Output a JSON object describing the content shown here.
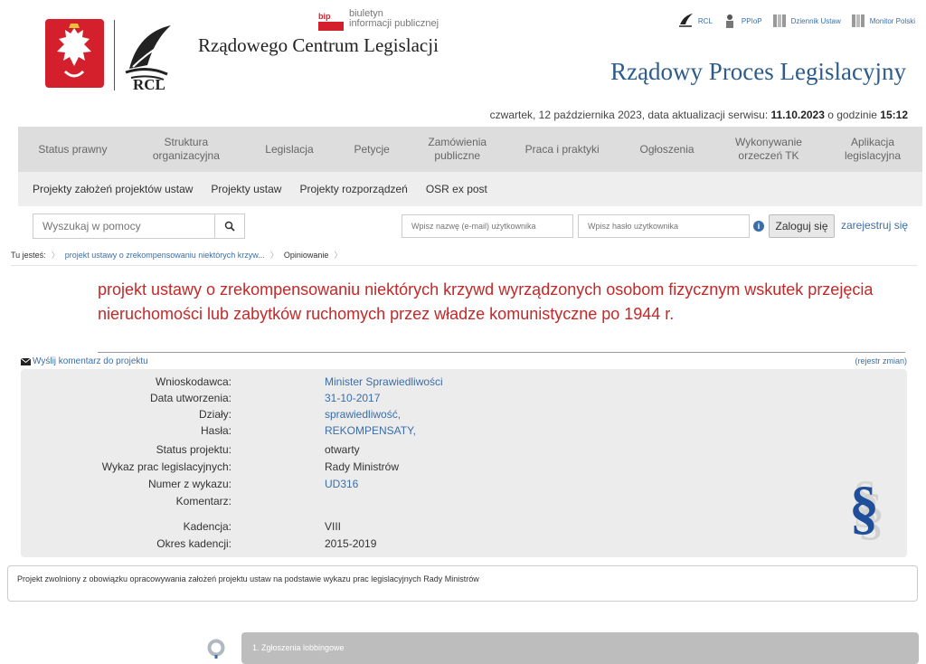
{
  "header": {
    "org_name": "Rządowego Centrum Legislacji",
    "rcl_label": "RCL",
    "bip": {
      "badge": "bip",
      "line1": "biuletyn",
      "line2": "informacji publicznej"
    },
    "top_links": [
      "RCL",
      "PPIoP",
      "Dziennik Ustaw",
      "Monitor Polski"
    ],
    "site_title": "Rządowy Proces Legislacyjny"
  },
  "dateline": {
    "prefix": "czwartek, 12 października 2023, data aktualizacji serwisu: ",
    "date": "11.10.2023",
    "mid": " o godzinie ",
    "time": "15:12"
  },
  "main_nav": [
    "Status prawny",
    "Struktura organizacyjna",
    "Legislacja",
    "Petycje",
    "Zamówienia publiczne",
    "Praca i praktyki",
    "Ogłoszenia",
    "Wykonywanie orzeczeń TK",
    "Aplikacja legislacyjna"
  ],
  "sub_nav": [
    "Projekty założeń projektów ustaw",
    "Projekty ustaw",
    "Projekty rozporządzeń",
    "OSR ex post"
  ],
  "search": {
    "placeholder": "Wyszukaj w pomocy"
  },
  "login": {
    "user_placeholder": "Wpisz nazwę (e-mail) użytkownika",
    "pass_placeholder": "Wpisz hasło użytkownika",
    "info": "i",
    "button": "Zaloguj się",
    "register": "zarejestruj się"
  },
  "breadcrumb": {
    "prefix": "Tu jesteś:",
    "items": [
      "projekt ustawy o zrekompensowaniu niektórych krzyw...",
      "Opiniowanie"
    ]
  },
  "project": {
    "title": "projekt ustawy o zrekompensowaniu niektórych krzywd wyrządzonych osobom fizycznym wskutek przejęcia nieruchomości lub zabytków ruchomych przez władze komunistyczne po 1944 r.",
    "send_comment": "Wyślij komentarz do projektu",
    "changelog": "(rejestr zmian)",
    "details": [
      {
        "label": "Wnioskodawca:",
        "value": "Minister Sprawiedliwości",
        "link": true
      },
      {
        "label": "Data utworzenia:",
        "value": "31-10-2017",
        "link": true
      },
      {
        "label": "Działy:",
        "value": "sprawiedliwość,",
        "link": true
      },
      {
        "label": "Hasła:",
        "value": "REKOMPENSATY,",
        "link": true
      },
      {
        "label": "Status projektu:",
        "value": "otwarty",
        "link": false
      },
      {
        "label": "Wykaz prac legislacyjnych:",
        "value": "Rady Ministrów",
        "link": false
      },
      {
        "label": "Numer z wykazu:",
        "value": "UD316",
        "link": true
      },
      {
        "label": "Komentarz:",
        "value": "",
        "link": false
      },
      {
        "label": "Kadencja:",
        "value": "VIII",
        "link": false
      },
      {
        "label": "Okres kadencji:",
        "value": "2015-2019",
        "link": false
      }
    ],
    "note": "Projekt zwolniony z obowiązku opracowywania założeń projektu ustaw na podstawie wykazu prac legislacyjnych Rady Ministrów"
  },
  "timeline": [
    {
      "label": "1. Zgłoszenia lobbingowe"
    }
  ],
  "colors": {
    "title_red": "#c62828",
    "link_blue": "#3b6ea8",
    "nav_bg": "#dddddd",
    "subnav_bg": "#eeeeee",
    "details_bg": "#ececec",
    "emblem_red": "#d4202c"
  }
}
